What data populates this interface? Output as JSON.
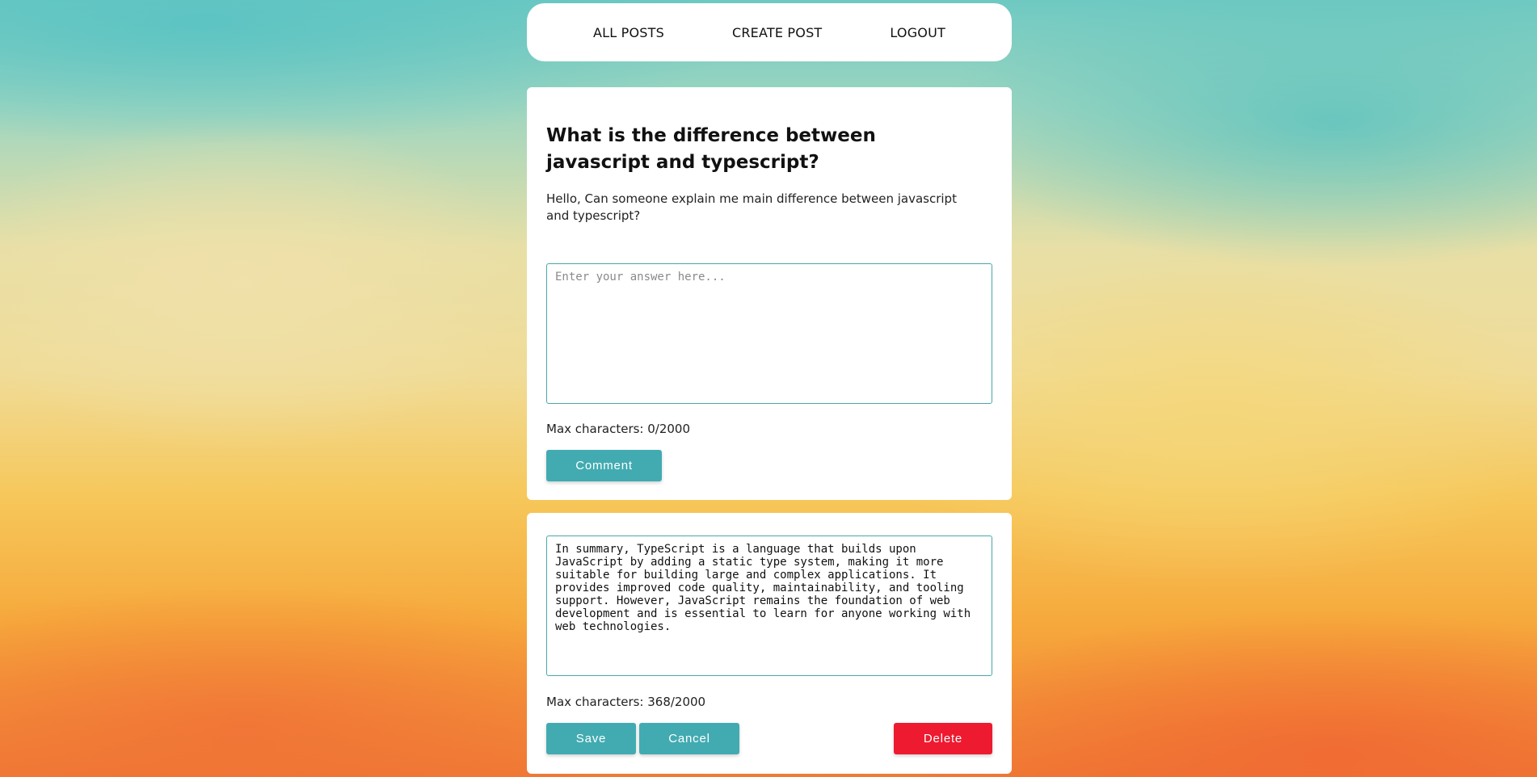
{
  "nav": {
    "all_posts": "ALL POSTS",
    "create_post": "CREATE POST",
    "logout": "LOGOUT"
  },
  "post": {
    "title": "What is the difference between javascript and typescript?",
    "body": "Hello, Can someone explain me main difference between javascript and typescript?"
  },
  "answer_form": {
    "placeholder": "Enter your answer here...",
    "value": "",
    "char_count": "Max characters: 0/2000",
    "submit_label": "Comment"
  },
  "comment_edit": {
    "value": "In summary, TypeScript is a language that builds upon JavaScript by adding a static type system, making it more suitable for building large and complex applications. It provides improved code quality, maintainability, and tooling support. However, JavaScript remains the foundation of web development and is essential to learn for anyone working with web technologies.",
    "char_count": "Max characters: 368/2000",
    "save_label": "Save",
    "cancel_label": "Cancel",
    "delete_label": "Delete"
  },
  "colors": {
    "accent_teal": "#42abb1",
    "danger_red": "#ee1a30",
    "card_bg": "#ffffff"
  }
}
